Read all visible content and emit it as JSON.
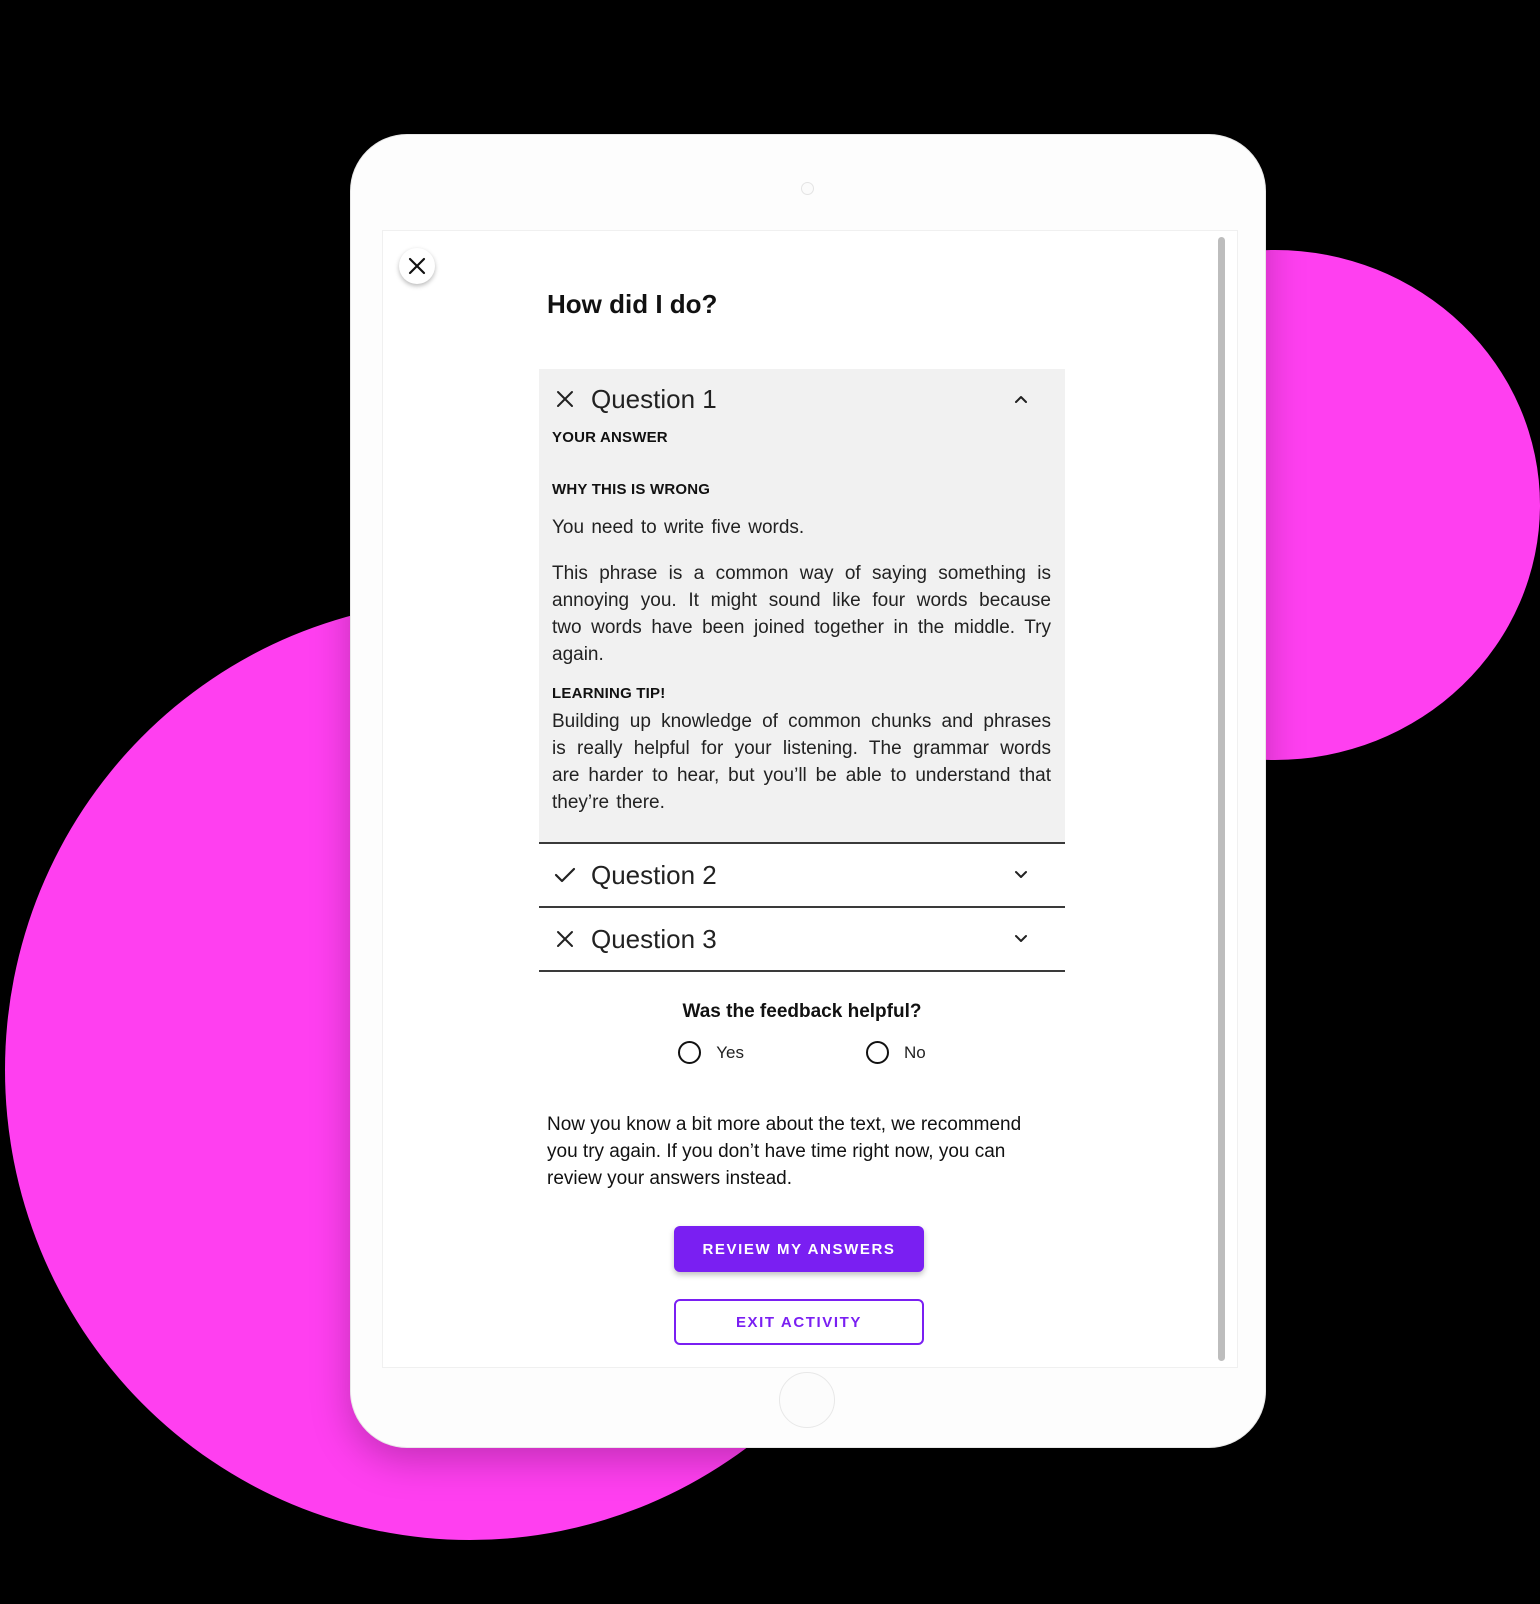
{
  "page": {
    "title": "How did I do?",
    "close_icon": "close-icon"
  },
  "accordion": {
    "items": [
      {
        "label": "Question 1",
        "status": "incorrect",
        "status_icon": "x-icon",
        "expanded": true,
        "chevron_icon": "chevron-up-icon",
        "your_answer_label": "YOUR ANSWER",
        "why_label": "WHY THIS IS WRONG",
        "explanation_1": "You need to write five words.",
        "explanation_2": "This phrase is a common way of saying something is annoying you. It might sound like four words because two words have been joined together in the middle. Try again.",
        "tip_label": "LEARNING TIP!",
        "tip_text": "Building up knowledge of common chunks and phrases is really helpful for your listening. The grammar words are harder to hear, but you’ll be able to understand that they’re there."
      },
      {
        "label": "Question 2",
        "status": "correct",
        "status_icon": "check-icon",
        "expanded": false,
        "chevron_icon": "chevron-down-icon"
      },
      {
        "label": "Question 3",
        "status": "incorrect",
        "status_icon": "x-icon",
        "expanded": false,
        "chevron_icon": "chevron-down-icon"
      }
    ]
  },
  "feedback": {
    "question": "Was the feedback helpful?",
    "options": [
      {
        "label": "Yes",
        "selected": false
      },
      {
        "label": "No",
        "selected": false
      }
    ]
  },
  "recommendation": "Now you know a bit more about the text, we recommend you try again. If you don’t have time right now, you can review your answers instead.",
  "buttons": {
    "primary": "REVIEW MY ANSWERS",
    "secondary": "EXIT ACTIVITY"
  },
  "colors": {
    "accent": "#7a1ff2",
    "background_blob": "#ff3ff0",
    "expanded_panel": "#f1f1f1"
  }
}
